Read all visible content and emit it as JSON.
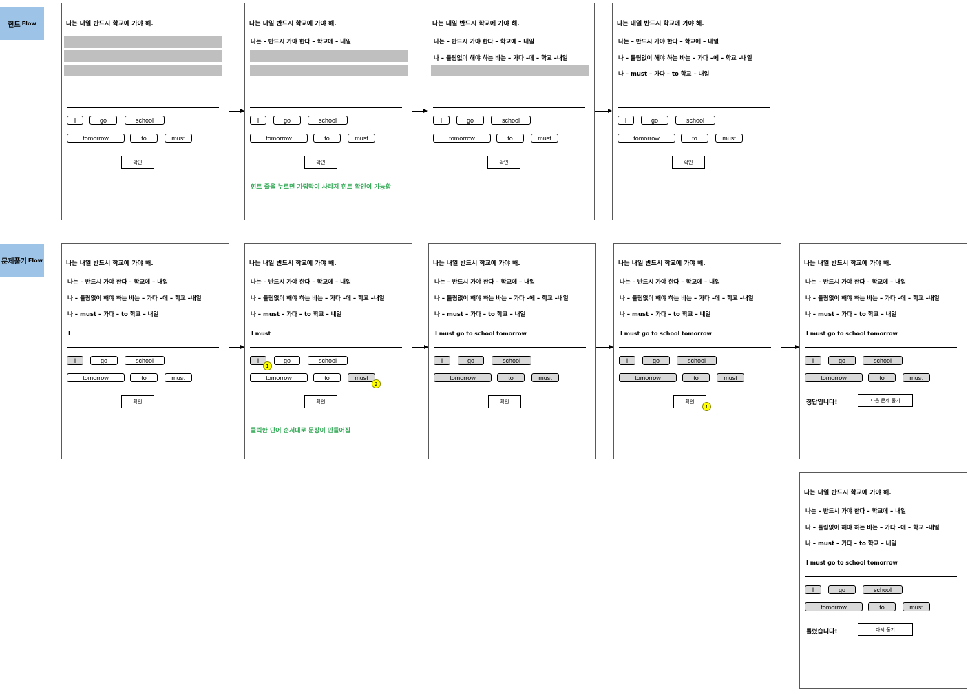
{
  "flows": {
    "hint_label": "힌트",
    "hint_suffix": "Flow",
    "solve_label": "문제풀기",
    "solve_suffix": "Flow"
  },
  "sentence": "나는 내일 반드시 학교에 가야 해.",
  "hints": [
    "나는 – 반드시 가야 한다 – 학교에 – 내일",
    "나 – 틀림없이 해야 하는 바는 – 가다 –에 – 학교 –내일",
    "나 – must – 가다 – to 학교 – 내일"
  ],
  "words": [
    "I",
    "go",
    "school",
    "tomorrow",
    "to",
    "must"
  ],
  "confirm_label": "확인",
  "answers": {
    "first": "I",
    "partial": "I must",
    "full": "I must go to school tomorrow"
  },
  "notes": {
    "hint": "힌트 줄을 누르면 가림막이 사라져 힌트 확인이 가능함",
    "solve": "클릭한 단어 순서대로 문장이 만들어짐"
  },
  "markers": [
    "1",
    "2",
    "1"
  ],
  "results": {
    "correct": "정답입니다!",
    "next_label": "다음 문제 풀기",
    "wrong": "틀렸습니다!",
    "retry_label": "다시 풀기"
  },
  "colors": {
    "flow_label_bg": "#9dc3e6",
    "cover_bar": "#bfbfbf",
    "selected_chip": "#d9d9d9",
    "note_text": "#33a956",
    "step_marker": "#ffff00"
  }
}
